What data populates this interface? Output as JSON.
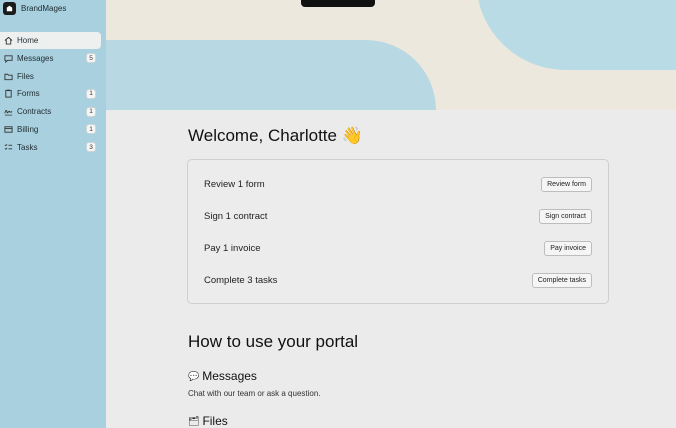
{
  "brand": {
    "name": "BrandMages"
  },
  "sidebar": {
    "items": [
      {
        "label": "Home",
        "icon": "home-icon",
        "badge": ""
      },
      {
        "label": "Messages",
        "icon": "message-icon",
        "badge": "5"
      },
      {
        "label": "Files",
        "icon": "folder-icon",
        "badge": ""
      },
      {
        "label": "Forms",
        "icon": "clipboard-icon",
        "badge": "1"
      },
      {
        "label": "Contracts",
        "icon": "signature-icon",
        "badge": "1"
      },
      {
        "label": "Billing",
        "icon": "card-icon",
        "badge": "1"
      },
      {
        "label": "Tasks",
        "icon": "checklist-icon",
        "badge": "3"
      }
    ]
  },
  "main": {
    "welcome": "Welcome, Charlotte",
    "welcome_emoji": "👋",
    "tasks": [
      {
        "label": "Review 1 form",
        "button": "Review form"
      },
      {
        "label": "Sign 1 contract",
        "button": "Sign contract"
      },
      {
        "label": "Pay 1 invoice",
        "button": "Pay invoice"
      },
      {
        "label": "Complete 3 tasks",
        "button": "Complete tasks"
      }
    ],
    "howto_title": "How to use your portal",
    "sections": [
      {
        "icon": "💬",
        "title": "Messages",
        "desc": "Chat with our team or ask a question."
      },
      {
        "icon": "🗂",
        "title": "Files",
        "desc": ""
      }
    ]
  },
  "colors": {
    "sidebar_bg": "#a9d0df",
    "hero_bg": "#ece8dd",
    "page_bg": "#ebebeb"
  }
}
